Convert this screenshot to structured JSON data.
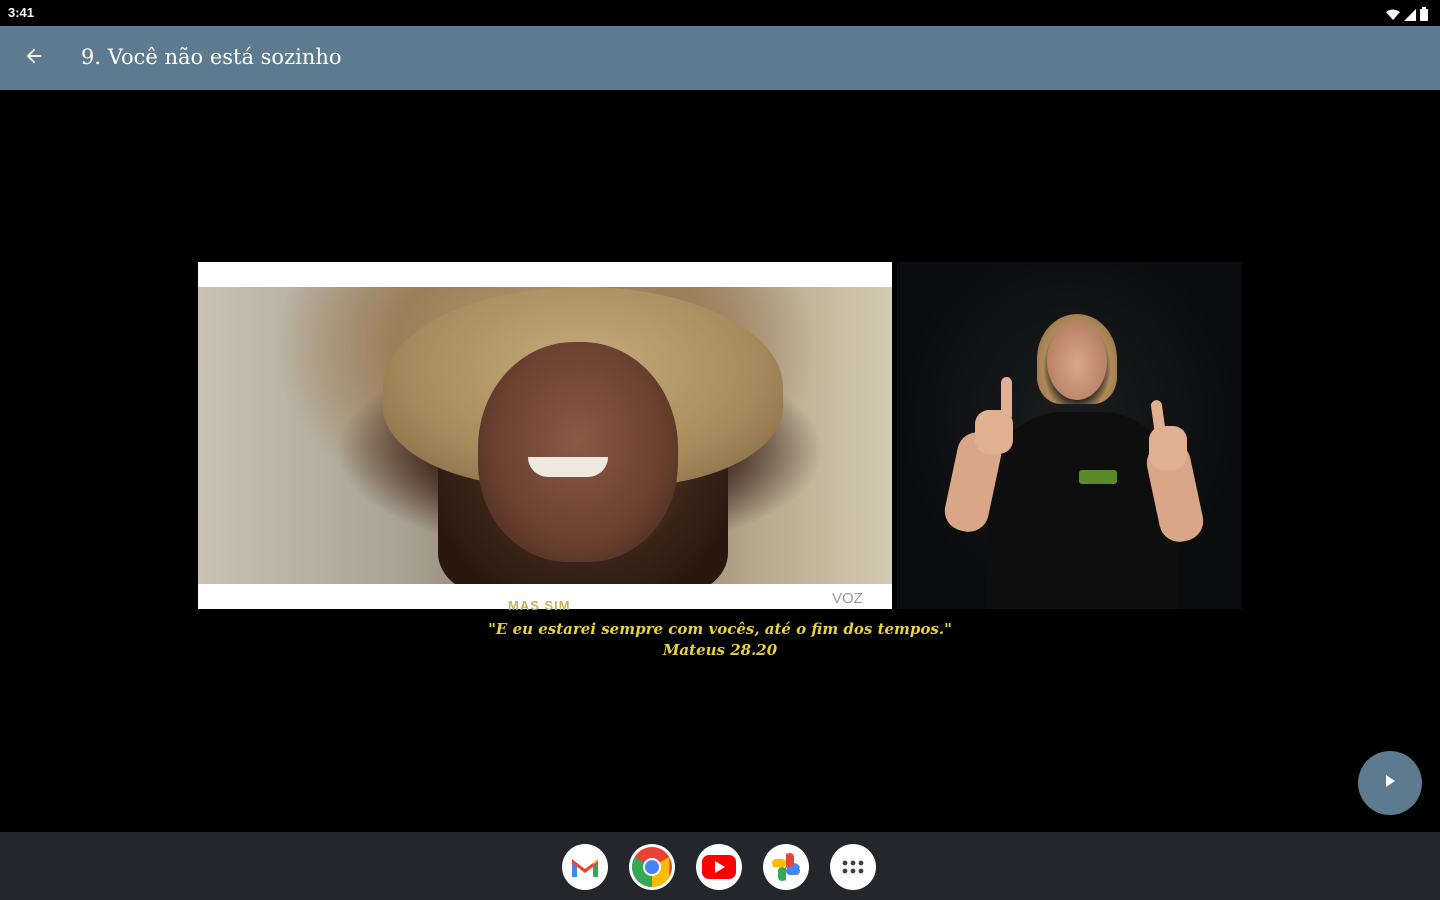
{
  "status_bar": {
    "time": "3:41",
    "icons": [
      "wifi-icon",
      "signal-icon",
      "battery-icon"
    ]
  },
  "app_bar": {
    "back_icon": "arrow-left-icon",
    "title": "9. Você não está sozinho"
  },
  "video": {
    "main_caption_fragment": "MAS SIM",
    "main_logo_text": "VOZ",
    "subtitle_line1": "\"E eu estarei sempre com vocês, até o fim dos tempos.\"",
    "subtitle_line2": "Mateus 28.20"
  },
  "play_button": {
    "icon": "play-icon"
  },
  "dock": {
    "apps": [
      "gmail-icon",
      "chrome-icon",
      "youtube-icon",
      "photos-icon",
      "app-drawer-icon"
    ]
  },
  "colors": {
    "app_bar": "#5e7a8e",
    "subtitle": "#e8d23a",
    "taskbar": "#23262a"
  }
}
